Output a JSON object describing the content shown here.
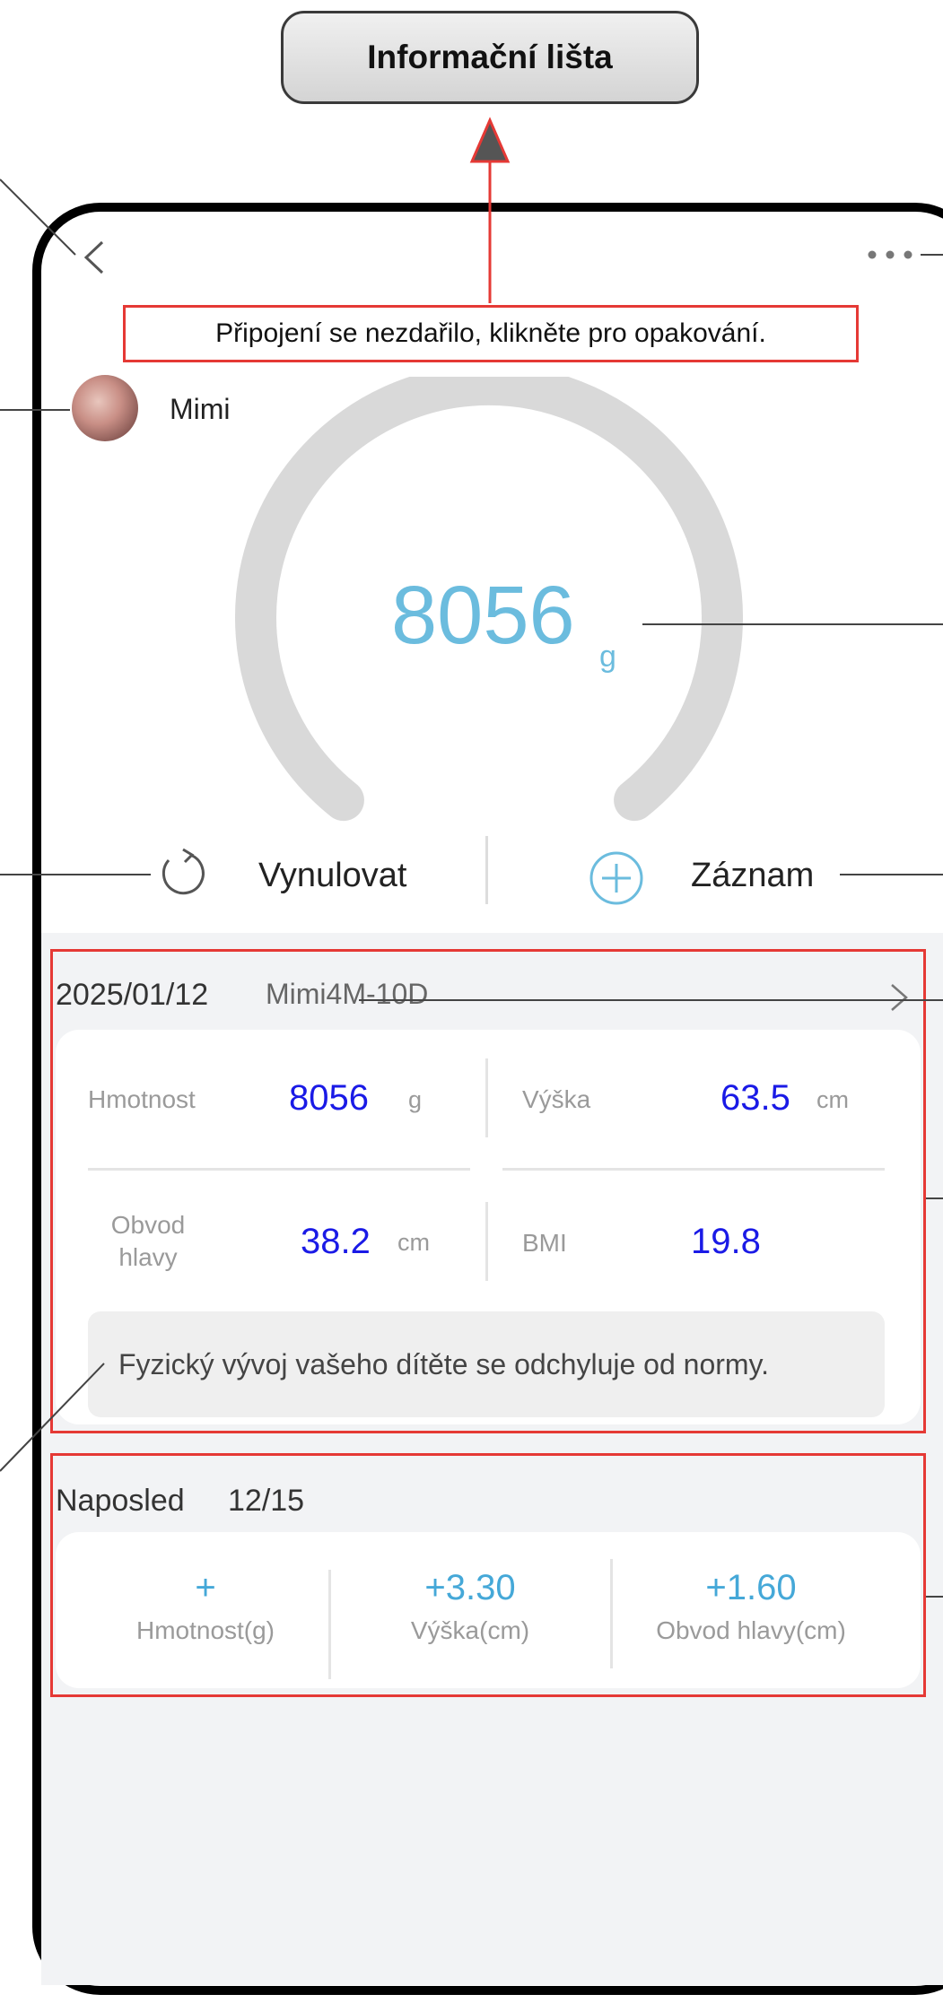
{
  "callout": {
    "title": "Informační lišta"
  },
  "header": {
    "back_icon": "chevron-left-icon",
    "more_icon": "more-horizontal-icon"
  },
  "status": {
    "error_text": "Připojení se nezdařilo, klikněte pro opakování."
  },
  "profile": {
    "name": "Mimi"
  },
  "scale": {
    "value": "8056",
    "unit": "g"
  },
  "actions": {
    "reset_label": "Vynulovat",
    "record_label": "Záznam"
  },
  "record": {
    "date": "2025/01/12",
    "subject": "Mimi4M-10D",
    "metrics": {
      "weight": {
        "label": "Hmotnost",
        "value": "8056",
        "unit": "g"
      },
      "height": {
        "label": "Výška",
        "value": "63.5",
        "unit": "cm"
      },
      "head_label_line1": "Obvod",
      "head_label_line2": "hlavy",
      "head": {
        "value": "38.2",
        "unit": "cm"
      },
      "bmi": {
        "label": "BMI",
        "value": "19.8"
      }
    },
    "note": "Fyzický vývoj vašeho dítěte se odchyluje od normy."
  },
  "last": {
    "label": "Naposled",
    "date": "12/15",
    "items": [
      {
        "value": "+",
        "label": "Hmotnost(g)"
      },
      {
        "value": "+3.30",
        "label": "Výška(cm)"
      },
      {
        "value": "+1.60",
        "label": "Obvod hlavy(cm)"
      }
    ]
  },
  "colors": {
    "accent": "#6bbcde",
    "metric_value": "#1a1ae6",
    "highlight_border": "#e53935",
    "gauge_track": "#d9d9d9"
  }
}
